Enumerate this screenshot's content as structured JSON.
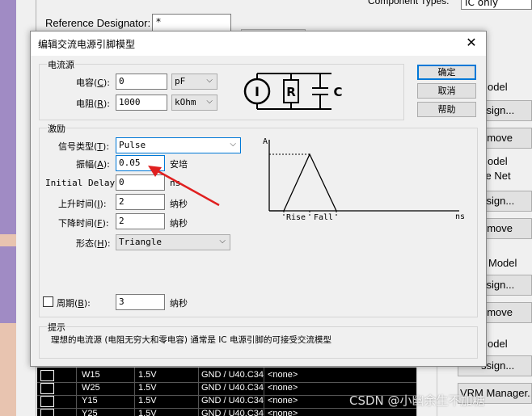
{
  "background_window": {
    "reference_designator_label": "Reference Designator:",
    "reference_designator_value": "*",
    "component_types_label": "Component Types:",
    "component_types_value": "IC only",
    "right_labels": [
      "odel",
      "odel",
      "ce Net",
      "Model",
      "odel"
    ],
    "right_buttons": [
      "ssign...",
      "emove",
      "ssign...",
      "emove",
      "ssign...",
      "emove",
      "ssign...",
      "VRM Manager..."
    ],
    "table_rows": [
      {
        "pin": "W15",
        "voltage": "1.5V",
        "net": "GND / U40.C34",
        "model": "<none>"
      },
      {
        "pin": "W25",
        "voltage": "1.5V",
        "net": "GND / U40.C34",
        "model": "<none>"
      },
      {
        "pin": "Y15",
        "voltage": "1.5V",
        "net": "GND / U40.C34",
        "model": "<none>"
      },
      {
        "pin": "Y25",
        "voltage": "1.5V",
        "net": "GND / U40.C34",
        "model": "<none>"
      }
    ],
    "watermark": "CSDN @小幽余生不加糖"
  },
  "dialog": {
    "title": "编辑交流电源引脚模型",
    "close_icon": "close-icon",
    "current_source_group": {
      "title": "电流源",
      "capacitance_label": "电容",
      "capacitance_hotkey": "C",
      "capacitance_value": "0",
      "capacitance_unit": "pF",
      "resistance_label": "电阻",
      "resistance_hotkey": "R",
      "resistance_value": "1000",
      "resistance_unit": "kOhm",
      "schematic": {
        "source": "I",
        "resistor": "R",
        "capacitor": "C"
      }
    },
    "buttons": {
      "ok": "确定",
      "cancel": "取消",
      "help": "帮助"
    },
    "stimulus_group": {
      "title": "激励",
      "signal_type_label": "信号类型",
      "signal_type_hotkey": "T",
      "signal_type_value": "Pulse",
      "amplitude_label": "振幅",
      "amplitude_hotkey": "A",
      "amplitude_value": "0.05",
      "amplitude_unit": "安培",
      "initial_delay_label": "Initial Delay:",
      "initial_delay_value": "0",
      "initial_delay_unit": "ns",
      "rise_time_label": "上升时间",
      "rise_time_hotkey": "I",
      "rise_time_value": "2",
      "rise_time_unit": "纳秒",
      "fall_time_label": "下降时间",
      "fall_time_hotkey": "F",
      "fall_time_value": "2",
      "fall_time_unit": "纳秒",
      "shape_label": "形态",
      "shape_hotkey": "H",
      "shape_value": "Triangle",
      "period_checkbox_label": "周期",
      "period_hotkey": "B",
      "period_checked": false,
      "period_value": "3",
      "period_unit": "纳秒",
      "waveform": {
        "y_axis_label": "A",
        "x_axis_label": "ns",
        "rise_label": "Rise",
        "fall_label": "Fall"
      }
    },
    "hint_group": {
      "title": "提示",
      "text": "理想的电流源 (电阻无穷大和零电容) 通常是 IC 电源引脚的可接受交流模型"
    }
  },
  "colors": {
    "accent": "#0078d7",
    "arrow": "#e02020",
    "table_bg": "#000000"
  }
}
